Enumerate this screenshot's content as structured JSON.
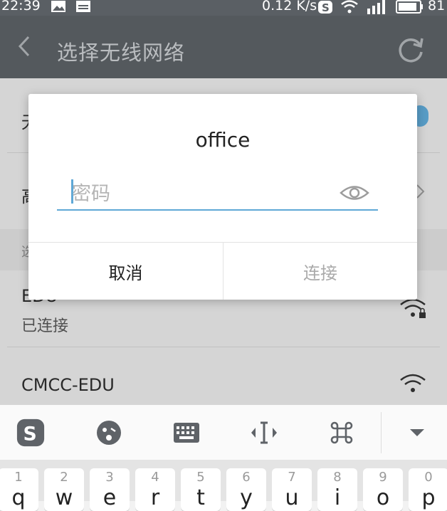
{
  "status_bar": {
    "time": "22:39",
    "net_speed": "0.12 K/s",
    "battery": "81"
  },
  "header": {
    "title": "选择无线网络"
  },
  "settings_rows": [
    {
      "label": "无"
    },
    {
      "label": "高"
    },
    {
      "label": "选"
    }
  ],
  "networks": [
    {
      "ssid": "EDU",
      "status": "已连接",
      "secured": true
    },
    {
      "ssid": "CMCC-EDU",
      "status": "",
      "secured": false
    }
  ],
  "dialog": {
    "title": "office",
    "password_placeholder": "密码",
    "cancel_label": "取消",
    "connect_label": "连接"
  },
  "keyboard": {
    "toolbar_icons": [
      "sogou-logo-icon",
      "emoji-icon",
      "keyboard-icon",
      "cursor-move-icon",
      "command-icon",
      "hide-keyboard-icon"
    ],
    "keys": [
      {
        "num": "1",
        "letter": "q"
      },
      {
        "num": "2",
        "letter": "w"
      },
      {
        "num": "3",
        "letter": "e"
      },
      {
        "num": "4",
        "letter": "r"
      },
      {
        "num": "5",
        "letter": "t"
      },
      {
        "num": "6",
        "letter": "y"
      },
      {
        "num": "7",
        "letter": "u"
      },
      {
        "num": "8",
        "letter": "i"
      },
      {
        "num": "9",
        "letter": "o"
      },
      {
        "num": "0",
        "letter": "p"
      }
    ]
  },
  "colors": {
    "accent": "#5fa8d6",
    "header_bg": "#5b6065",
    "dialog_bg": "#ffffff"
  }
}
